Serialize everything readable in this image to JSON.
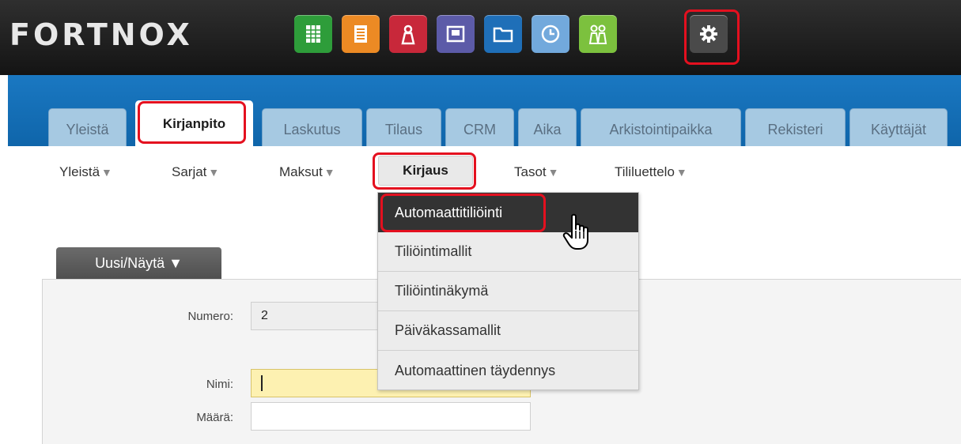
{
  "app": {
    "logo": "FORTNOX"
  },
  "toolbar": {
    "icons": [
      {
        "name": "spreadsheet-icon",
        "color": "#2e9d3a"
      },
      {
        "name": "document-icon",
        "color": "#ec8a24"
      },
      {
        "name": "person-icon",
        "color": "#c8283a"
      },
      {
        "name": "window-icon",
        "color": "#5c5ba8"
      },
      {
        "name": "folder-icon",
        "color": "#1f6fb8"
      },
      {
        "name": "clock-icon",
        "color": "#72a9dc"
      },
      {
        "name": "users-icon",
        "color": "#7cc13e"
      },
      {
        "name": "settings-gear-icon",
        "color": "#4a4a4a"
      }
    ]
  },
  "tabs": [
    "Yleistä",
    "Kirjanpito",
    "Laskutus",
    "Tilaus",
    "CRM",
    "Aika",
    "Arkistointipaikka",
    "Rekisteri",
    "Käyttäjät"
  ],
  "active_tab": "Kirjanpito",
  "subnav": [
    "Yleistä",
    "Sarjat",
    "Maksut",
    "Kirjaus",
    "Tasot",
    "Tililuettelo"
  ],
  "subnav_arrow": "▼",
  "active_subnav": "Kirjaus",
  "dropdown": [
    "Automaattitiliöinti",
    "Tiliöintimallit",
    "Tiliöintinäkymä",
    "Päiväkassamallit",
    "Automaattinen täydennys"
  ],
  "panel": {
    "tab_label": "Uusi/Näytä ▼",
    "numero_label": "Numero:",
    "numero_value": "2",
    "nimi_label": "Nimi:",
    "nimi_value": "",
    "maara_label": "Määrä:",
    "maara_value": ""
  },
  "colors": {
    "highlight": "#e4101f",
    "blue": "#1370b8"
  }
}
